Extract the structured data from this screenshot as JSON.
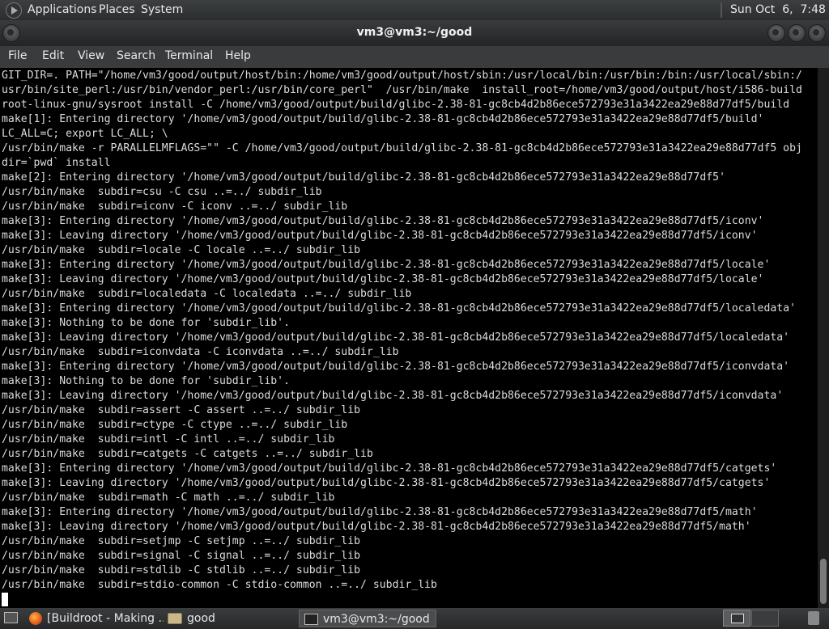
{
  "top_panel": {
    "applications": "Applications",
    "places": "Places",
    "system": "System",
    "clock": "Sun Oct  6,  7:48 PM"
  },
  "window": {
    "title": "vm3@vm3:~/good"
  },
  "menu": {
    "file": "File",
    "edit": "Edit",
    "view": "View",
    "search": "Search",
    "terminal": "Terminal",
    "help": "Help"
  },
  "terminal": {
    "lines": [
      "GIT_DIR=. PATH=\"/home/vm3/good/output/host/bin:/home/vm3/good/output/host/sbin:/usr/local/bin:/usr/bin:/bin:/usr/local/sbin:/",
      "usr/bin/site_perl:/usr/bin/vendor_perl:/usr/bin/core_perl\"  /usr/bin/make  install_root=/home/vm3/good/output/host/i586-build",
      "root-linux-gnu/sysroot install -C /home/vm3/good/output/build/glibc-2.38-81-gc8cb4d2b86ece572793e31a3422ea29e88d77df5/build",
      "make[1]: Entering directory '/home/vm3/good/output/build/glibc-2.38-81-gc8cb4d2b86ece572793e31a3422ea29e88d77df5/build'",
      "LC_ALL=C; export LC_ALL; \\",
      "/usr/bin/make -r PARALLELMFLAGS=\"\" -C /home/vm3/good/output/build/glibc-2.38-81-gc8cb4d2b86ece572793e31a3422ea29e88d77df5 obj",
      "dir=`pwd` install",
      "make[2]: Entering directory '/home/vm3/good/output/build/glibc-2.38-81-gc8cb4d2b86ece572793e31a3422ea29e88d77df5'",
      "/usr/bin/make  subdir=csu -C csu ..=../ subdir_lib",
      "/usr/bin/make  subdir=iconv -C iconv ..=../ subdir_lib",
      "make[3]: Entering directory '/home/vm3/good/output/build/glibc-2.38-81-gc8cb4d2b86ece572793e31a3422ea29e88d77df5/iconv'",
      "make[3]: Leaving directory '/home/vm3/good/output/build/glibc-2.38-81-gc8cb4d2b86ece572793e31a3422ea29e88d77df5/iconv'",
      "/usr/bin/make  subdir=locale -C locale ..=../ subdir_lib",
      "make[3]: Entering directory '/home/vm3/good/output/build/glibc-2.38-81-gc8cb4d2b86ece572793e31a3422ea29e88d77df5/locale'",
      "make[3]: Leaving directory '/home/vm3/good/output/build/glibc-2.38-81-gc8cb4d2b86ece572793e31a3422ea29e88d77df5/locale'",
      "/usr/bin/make  subdir=localedata -C localedata ..=../ subdir_lib",
      "make[3]: Entering directory '/home/vm3/good/output/build/glibc-2.38-81-gc8cb4d2b86ece572793e31a3422ea29e88d77df5/localedata'",
      "make[3]: Nothing to be done for 'subdir_lib'.",
      "make[3]: Leaving directory '/home/vm3/good/output/build/glibc-2.38-81-gc8cb4d2b86ece572793e31a3422ea29e88d77df5/localedata'",
      "/usr/bin/make  subdir=iconvdata -C iconvdata ..=../ subdir_lib",
      "make[3]: Entering directory '/home/vm3/good/output/build/glibc-2.38-81-gc8cb4d2b86ece572793e31a3422ea29e88d77df5/iconvdata'",
      "make[3]: Nothing to be done for 'subdir_lib'.",
      "make[3]: Leaving directory '/home/vm3/good/output/build/glibc-2.38-81-gc8cb4d2b86ece572793e31a3422ea29e88d77df5/iconvdata'",
      "/usr/bin/make  subdir=assert -C assert ..=../ subdir_lib",
      "/usr/bin/make  subdir=ctype -C ctype ..=../ subdir_lib",
      "/usr/bin/make  subdir=intl -C intl ..=../ subdir_lib",
      "/usr/bin/make  subdir=catgets -C catgets ..=../ subdir_lib",
      "make[3]: Entering directory '/home/vm3/good/output/build/glibc-2.38-81-gc8cb4d2b86ece572793e31a3422ea29e88d77df5/catgets'",
      "make[3]: Leaving directory '/home/vm3/good/output/build/glibc-2.38-81-gc8cb4d2b86ece572793e31a3422ea29e88d77df5/catgets'",
      "/usr/bin/make  subdir=math -C math ..=../ subdir_lib",
      "make[3]: Entering directory '/home/vm3/good/output/build/glibc-2.38-81-gc8cb4d2b86ece572793e31a3422ea29e88d77df5/math'",
      "make[3]: Leaving directory '/home/vm3/good/output/build/glibc-2.38-81-gc8cb4d2b86ece572793e31a3422ea29e88d77df5/math'",
      "/usr/bin/make  subdir=setjmp -C setjmp ..=../ subdir_lib",
      "/usr/bin/make  subdir=signal -C signal ..=../ subdir_lib",
      "/usr/bin/make  subdir=stdlib -C stdlib ..=../ subdir_lib",
      "/usr/bin/make  subdir=stdio-common -C stdio-common ..=../ subdir_lib"
    ]
  },
  "taskbar": {
    "tasks": [
      {
        "label": "[Buildroot - Making ..."
      },
      {
        "label": "good"
      },
      {
        "label": "vm3@vm3:~/good"
      }
    ]
  },
  "icons": {
    "menu": "app-menu-icon",
    "show_desktop": "show-desktop-icon",
    "firefox": "firefox-icon",
    "folder": "folder-icon",
    "terminal": "terminal-icon",
    "trash": "trash-icon"
  }
}
